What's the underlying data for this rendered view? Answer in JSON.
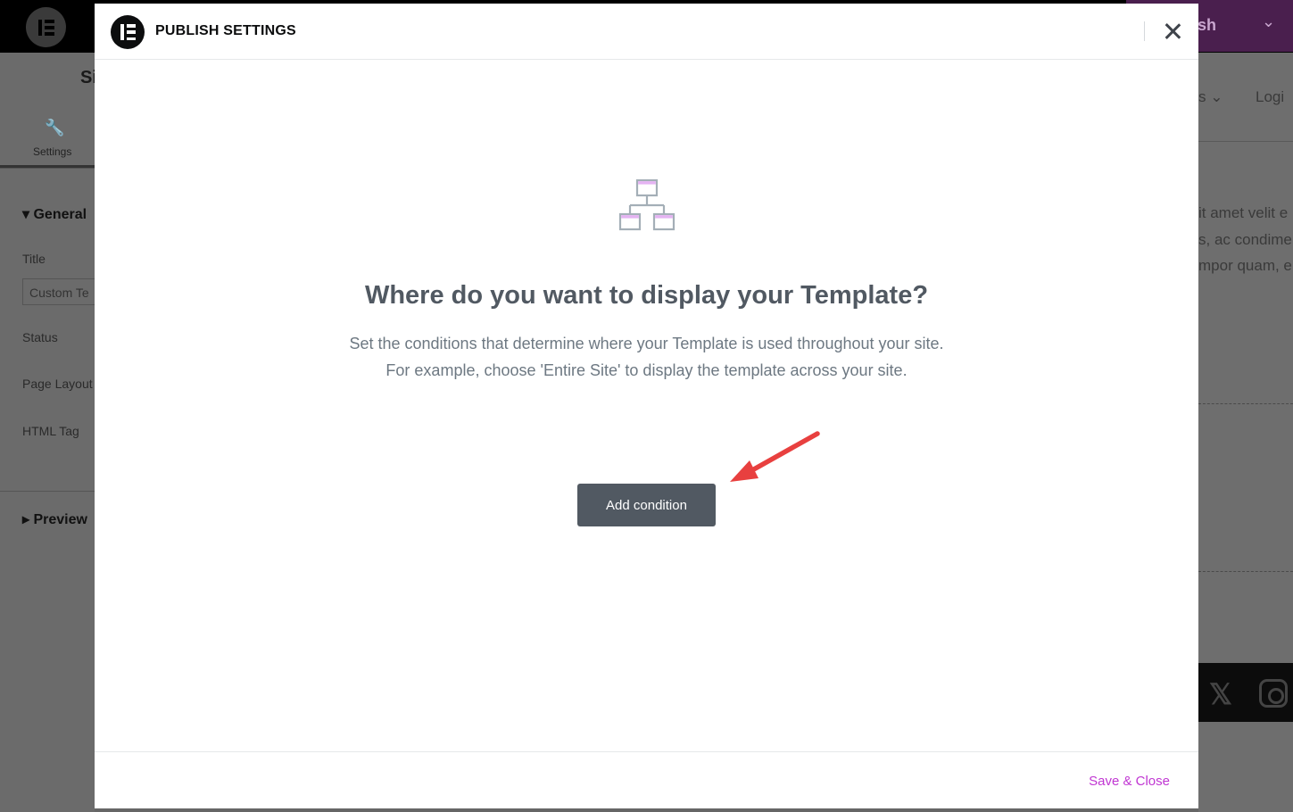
{
  "editor": {
    "site_title": "Si",
    "settings_tab": "Settings",
    "general_heading": "General",
    "title_label": "Title",
    "title_value": "Custom Te",
    "status_label": "Status",
    "page_layout_label": "Page Layout",
    "html_tag_label": "HTML Tag",
    "preview_heading": "Preview",
    "publish_label": "sh",
    "preview_nav": [
      "s ⌄",
      "Logi"
    ],
    "preview_text": [
      "it amet velit e",
      "s, ac condimer",
      "mpor quam, e"
    ]
  },
  "modal": {
    "title": "PUBLISH SETTINGS",
    "heading": "Where do you want to display your Template?",
    "description_line1": "Set the conditions that determine where your Template is used throughout your site.",
    "description_line2": "For example, choose 'Entire Site' to display the template across your site.",
    "add_condition_label": "Add condition",
    "save_close_label": "Save & Close"
  },
  "colors": {
    "accent": "#c036d2",
    "button_bg": "#515962",
    "annotation_arrow": "#e8403f",
    "icon_highlight": "#e4b3f2"
  }
}
